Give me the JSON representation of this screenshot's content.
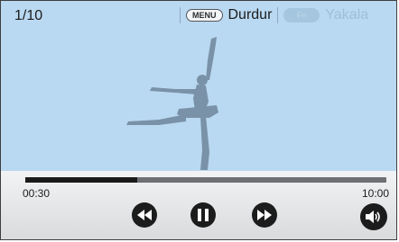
{
  "player": {
    "counter": "1/10",
    "menu_key": "MENU",
    "pause_label": "Durdur",
    "fn_key": "Fn",
    "capture_label": "Yakala"
  },
  "playback": {
    "elapsed": "00:30",
    "total": "10:00",
    "progress_fraction": 0.31
  },
  "icons": [
    "rewind-icon",
    "pause-icon",
    "fast-forward-icon",
    "volume-icon"
  ],
  "colors": {
    "background": "#b9d8f1",
    "silhouette": "#7a92a8",
    "controls": "#1c1c1c"
  }
}
